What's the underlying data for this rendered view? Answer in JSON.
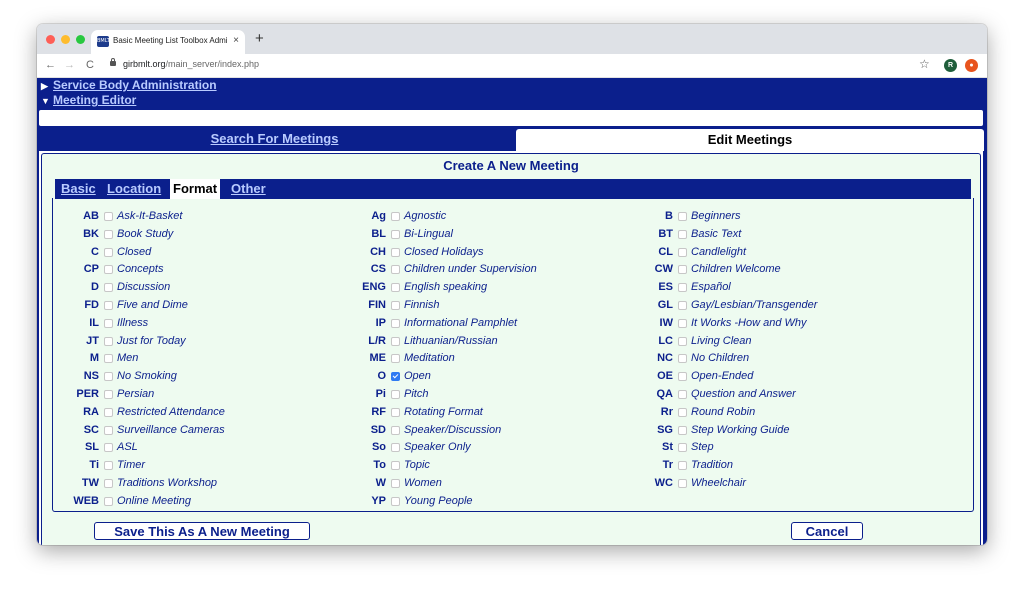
{
  "browser": {
    "tab_title": "Basic Meeting List Toolbox Admi",
    "tab_close": "×",
    "new_tab": "+",
    "url_host": "girbmlt.org",
    "url_path": "/main_server/index.php",
    "nav_back": "←",
    "nav_forward": "→",
    "nav_reload": "C",
    "bookmark": "☆",
    "ext1": "R",
    "ext2": "●"
  },
  "page": {
    "service_body_admin": "Service Body Administration",
    "meeting_editor": "Meeting Editor",
    "tabs": {
      "search": "Search For Meetings",
      "edit": "Edit Meetings"
    },
    "panel_title": "Create A New Meeting",
    "subtabs": [
      "Basic",
      "Location",
      "Format",
      "Other"
    ],
    "active_subtab": "Format",
    "formats": [
      [
        {
          "code": "AB",
          "name": "Ask-It-Basket",
          "checked": false
        },
        {
          "code": "BK",
          "name": "Book Study",
          "checked": false
        },
        {
          "code": "C",
          "name": "Closed",
          "checked": false
        },
        {
          "code": "CP",
          "name": "Concepts",
          "checked": false
        },
        {
          "code": "D",
          "name": "Discussion",
          "checked": false
        },
        {
          "code": "FD",
          "name": "Five and Dime",
          "checked": false
        },
        {
          "code": "IL",
          "name": "Illness",
          "checked": false
        },
        {
          "code": "JT",
          "name": "Just for Today",
          "checked": false
        },
        {
          "code": "M",
          "name": "Men",
          "checked": false
        },
        {
          "code": "NS",
          "name": "No Smoking",
          "checked": false
        },
        {
          "code": "PER",
          "name": "Persian",
          "checked": false
        },
        {
          "code": "RA",
          "name": "Restricted Attendance",
          "checked": false
        },
        {
          "code": "SC",
          "name": "Surveillance Cameras",
          "checked": false
        },
        {
          "code": "SL",
          "name": "ASL",
          "checked": false
        },
        {
          "code": "Ti",
          "name": "Timer",
          "checked": false
        },
        {
          "code": "TW",
          "name": "Traditions Workshop",
          "checked": false
        },
        {
          "code": "WEB",
          "name": "Online Meeting",
          "checked": false
        }
      ],
      [
        {
          "code": "Ag",
          "name": "Agnostic",
          "checked": false
        },
        {
          "code": "BL",
          "name": "Bi-Lingual",
          "checked": false
        },
        {
          "code": "CH",
          "name": "Closed Holidays",
          "checked": false
        },
        {
          "code": "CS",
          "name": "Children under Supervision",
          "checked": false
        },
        {
          "code": "ENG",
          "name": "English speaking",
          "checked": false
        },
        {
          "code": "FIN",
          "name": "Finnish",
          "checked": false
        },
        {
          "code": "IP",
          "name": "Informational Pamphlet",
          "checked": false
        },
        {
          "code": "L/R",
          "name": "Lithuanian/Russian",
          "checked": false
        },
        {
          "code": "ME",
          "name": "Meditation",
          "checked": false
        },
        {
          "code": "O",
          "name": "Open",
          "checked": true
        },
        {
          "code": "Pi",
          "name": "Pitch",
          "checked": false
        },
        {
          "code": "RF",
          "name": "Rotating Format",
          "checked": false
        },
        {
          "code": "SD",
          "name": "Speaker/Discussion",
          "checked": false
        },
        {
          "code": "So",
          "name": "Speaker Only",
          "checked": false
        },
        {
          "code": "To",
          "name": "Topic",
          "checked": false
        },
        {
          "code": "W",
          "name": "Women",
          "checked": false
        },
        {
          "code": "YP",
          "name": "Young People",
          "checked": false
        }
      ],
      [
        {
          "code": "B",
          "name": "Beginners",
          "checked": false
        },
        {
          "code": "BT",
          "name": "Basic Text",
          "checked": false
        },
        {
          "code": "CL",
          "name": "Candlelight",
          "checked": false
        },
        {
          "code": "CW",
          "name": "Children Welcome",
          "checked": false
        },
        {
          "code": "ES",
          "name": "Español",
          "checked": false
        },
        {
          "code": "GL",
          "name": "Gay/Lesbian/Transgender",
          "checked": false
        },
        {
          "code": "IW",
          "name": "It Works -How and Why",
          "checked": false
        },
        {
          "code": "LC",
          "name": "Living Clean",
          "checked": false
        },
        {
          "code": "NC",
          "name": "No Children",
          "checked": false
        },
        {
          "code": "OE",
          "name": "Open-Ended",
          "checked": false
        },
        {
          "code": "QA",
          "name": "Question and Answer",
          "checked": false
        },
        {
          "code": "Rr",
          "name": "Round Robin",
          "checked": false
        },
        {
          "code": "SG",
          "name": "Step Working Guide",
          "checked": false
        },
        {
          "code": "St",
          "name": "Step",
          "checked": false
        },
        {
          "code": "Tr",
          "name": "Tradition",
          "checked": false
        },
        {
          "code": "WC",
          "name": "Wheelchair",
          "checked": false
        }
      ]
    ],
    "save_button": "Save This As A New Meeting",
    "cancel_button": "Cancel"
  },
  "colors": {
    "navy": "#0b1f8c",
    "link": "#b9cbff",
    "panel_bg": "#eefbf0",
    "check": "#2f7bf2"
  }
}
